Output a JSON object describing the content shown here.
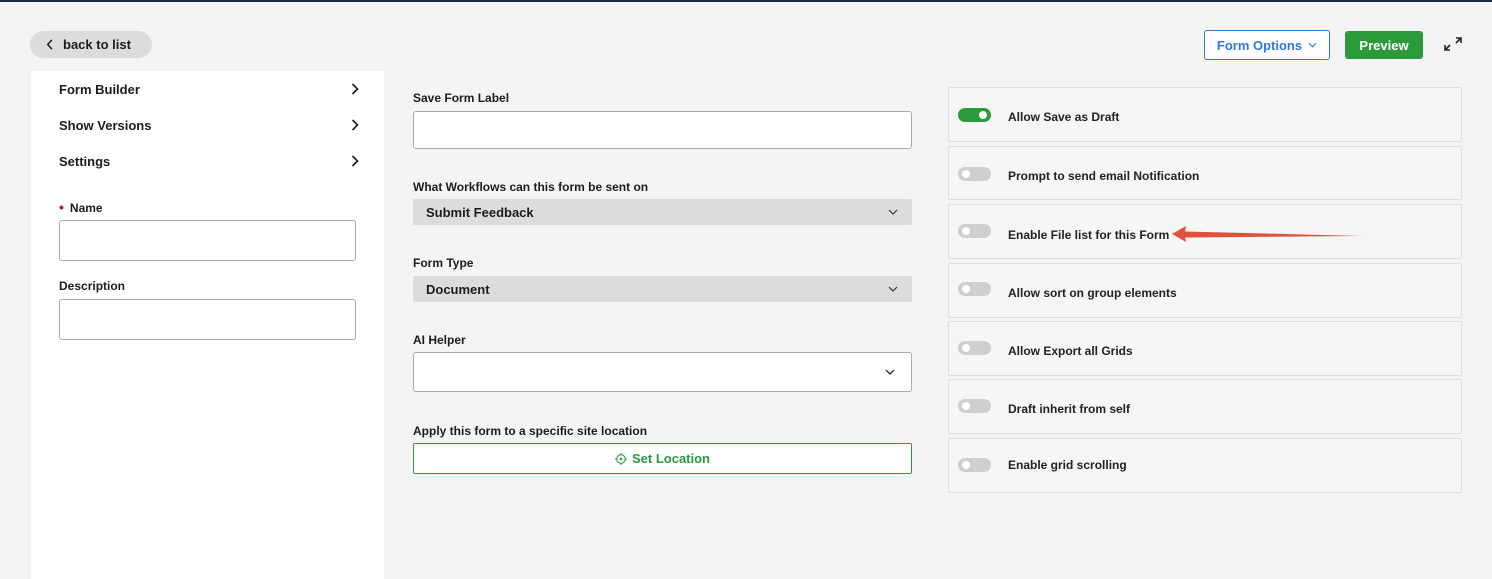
{
  "header": {
    "back_label": "back to list",
    "form_options_label": "Form Options",
    "preview_label": "Preview"
  },
  "left_panel": {
    "nav_items": [
      {
        "label": "Form Builder"
      },
      {
        "label": "Show Versions"
      },
      {
        "label": "Settings"
      }
    ],
    "name_label": "Name",
    "name_value": "",
    "description_label": "Description",
    "description_value": ""
  },
  "middle": {
    "save_form_label": "Save Form Label",
    "save_form_value": "",
    "workflows_label": "What Workflows can this form be sent on",
    "workflows_value": "Submit Feedback",
    "form_type_label": "Form Type",
    "form_type_value": "Document",
    "ai_helper_label": "AI Helper",
    "ai_helper_value": "",
    "site_location_label": "Apply this form to a specific site location",
    "set_location_label": "Set Location"
  },
  "toggles": [
    {
      "label": "Allow Save as Draft",
      "on": true
    },
    {
      "label": "Prompt to send email Notification",
      "on": false
    },
    {
      "label": "Enable File list for this Form",
      "on": false
    },
    {
      "label": "Allow sort on group elements",
      "on": false
    },
    {
      "label": "Allow Export all Grids",
      "on": false
    },
    {
      "label": "Draft inherit from self",
      "on": false
    },
    {
      "label": "Enable grid scrolling",
      "on": false
    }
  ],
  "colors": {
    "accent_green": "#2a9a3a",
    "accent_blue": "#2e79d8",
    "required_red": "#c0121e",
    "annotation_red": "#e0503a"
  },
  "icons": {
    "back": "chevron-left-icon",
    "form_options": "chevron-down-icon",
    "expand": "expand-icon",
    "nav": "chevron-right-icon",
    "select": "chevron-down-icon",
    "location": "crosshair-icon"
  }
}
